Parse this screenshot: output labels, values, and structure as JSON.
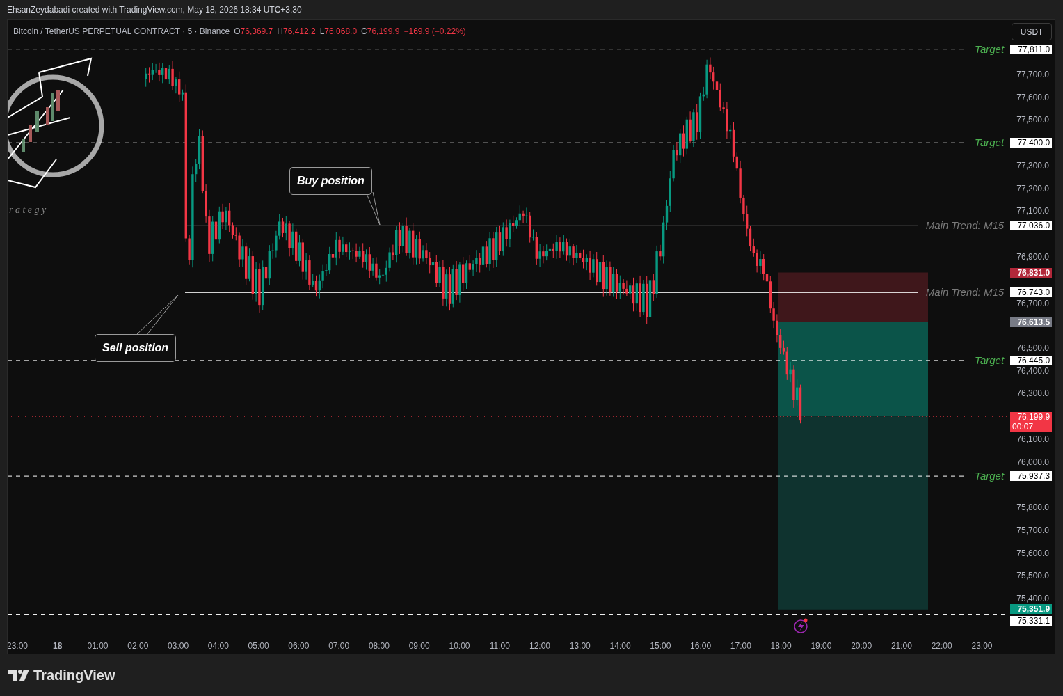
{
  "attribution": "EhsanZeydabadi created with TradingView.com, May 18, 2026 18:34 UTC+3:30",
  "legend": {
    "symbol": "Bitcoin / TetherUS PERPETUAL CONTRACT · 5 · Binance",
    "ohlc": [
      {
        "label": "O",
        "value": "76,369.7"
      },
      {
        "label": "H",
        "value": "76,412.2"
      },
      {
        "label": "L",
        "value": "76,068.0"
      },
      {
        "label": "C",
        "value": "76,199.9"
      }
    ],
    "change": "−169.9 (−0.22%)"
  },
  "currency_button": "USDT",
  "logo_caption": "r a t e g y",
  "price_axis": [
    "77,700.0",
    "77,600.0",
    "77,500.0",
    "77,300.0",
    "77,200.0",
    "77,100.0",
    "76,900.0",
    "76,700.0",
    "76,500.0",
    "76,400.0",
    "76,300.0",
    "76,100.0",
    "76,000.0",
    "75,800.0",
    "75,700.0",
    "75,600.0",
    "75,500.0",
    "75,400.0"
  ],
  "time_axis": [
    {
      "label": "23:00",
      "kind": "time"
    },
    {
      "label": "18",
      "kind": "day"
    },
    {
      "label": "01:00",
      "kind": "time"
    },
    {
      "label": "02:00",
      "kind": "time"
    },
    {
      "label": "03:00",
      "kind": "time"
    },
    {
      "label": "04:00",
      "kind": "time"
    },
    {
      "label": "05:00",
      "kind": "time"
    },
    {
      "label": "06:00",
      "kind": "time"
    },
    {
      "label": "07:00",
      "kind": "time"
    },
    {
      "label": "08:00",
      "kind": "time"
    },
    {
      "label": "09:00",
      "kind": "time"
    },
    {
      "label": "10:00",
      "kind": "time"
    },
    {
      "label": "11:00",
      "kind": "time"
    },
    {
      "label": "12:00",
      "kind": "time"
    },
    {
      "label": "13:00",
      "kind": "time"
    },
    {
      "label": "14:00",
      "kind": "time"
    },
    {
      "label": "15:00",
      "kind": "time"
    },
    {
      "label": "16:00",
      "kind": "time"
    },
    {
      "label": "17:00",
      "kind": "time"
    },
    {
      "label": "18:00",
      "kind": "time"
    },
    {
      "label": "19:00",
      "kind": "time"
    },
    {
      "label": "20:00",
      "kind": "time"
    },
    {
      "label": "21:00",
      "kind": "time"
    },
    {
      "label": "22:00",
      "kind": "time"
    },
    {
      "label": "23:00",
      "kind": "time"
    }
  ],
  "levels": [
    {
      "kind": "target",
      "label": "Target",
      "price": "77,811.0"
    },
    {
      "kind": "target",
      "label": "Target",
      "price": "77,400.0"
    },
    {
      "kind": "trend",
      "label": "Main Trend: M15",
      "price": "77,036.0"
    },
    {
      "kind": "trend",
      "label": "Main Trend: M15",
      "price": "76,743.0"
    },
    {
      "kind": "target",
      "label": "Target",
      "price": "76,445.0"
    },
    {
      "kind": "target",
      "label": "Target",
      "price": "75,937.3"
    },
    {
      "kind": "plain",
      "price": "75,331.1"
    }
  ],
  "position": {
    "stop": "76,831.0",
    "entry": "76,613.5",
    "target": "75,351.9"
  },
  "last_price": {
    "price": "76,199.9",
    "countdown": "00:07"
  },
  "callouts": [
    {
      "kind": "buy",
      "text": "Buy position"
    },
    {
      "kind": "sell",
      "text": "Sell position"
    }
  ],
  "footer_brand": "TradingView"
}
